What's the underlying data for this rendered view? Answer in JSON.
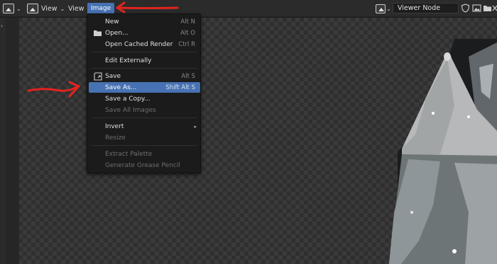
{
  "header": {
    "editor_type_icon": "image-editor-icon",
    "view_menu": "View",
    "view_label": "View",
    "image_menu": "Image",
    "image_browser_icon": "image-browse-icon",
    "image_name": "Viewer Node",
    "right_icons": [
      "shield-icon",
      "image-icon",
      "folder-icon",
      "close-icon"
    ]
  },
  "image_menu": {
    "items": [
      {
        "label": "New",
        "shortcut": "Alt N"
      },
      {
        "label": "Open...",
        "shortcut": "Alt O",
        "icon": "folder-icon"
      },
      {
        "label": "Open Cached Render",
        "shortcut": "Ctrl R"
      },
      {
        "label": "Edit Externally",
        "shortcut": ""
      },
      {
        "label": "Save",
        "shortcut": "Alt S",
        "icon": "save-icon"
      },
      {
        "label": "Save As...",
        "shortcut": "Shift Alt S"
      },
      {
        "label": "Save a Copy...",
        "shortcut": ""
      },
      {
        "label": "Save All Images",
        "shortcut": ""
      },
      {
        "label": "Invert",
        "shortcut": "",
        "submenu": "▸"
      },
      {
        "label": "Resize",
        "shortcut": ""
      },
      {
        "label": "Extract Palette",
        "shortcut": ""
      },
      {
        "label": "Generate Grease Pencil",
        "shortcut": ""
      }
    ]
  },
  "colors": {
    "accent": "#4772b3",
    "annotation": "#e0241f",
    "menu_bg": "#1b1b1b"
  }
}
